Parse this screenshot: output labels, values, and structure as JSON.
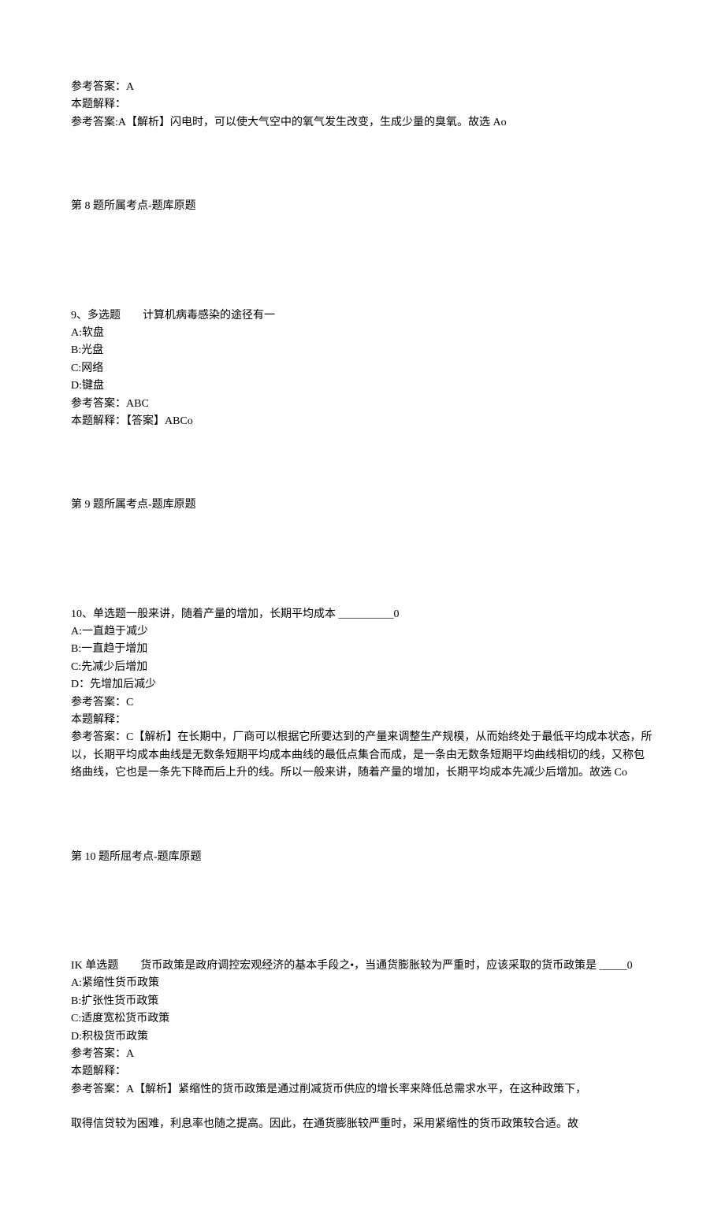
{
  "q8tail": {
    "ref_answer_label": "参考答案：A",
    "explain_label": "本题解释：",
    "explain_text": "参考答案:A【解析】闪电时，可以使大气空中的氧气发生改变，生成少量的臭氧。故选 Ao",
    "topic_label": "第 8 题所属考点-题库原题"
  },
  "q9": {
    "stem": "9、多选题　　计算机病毒感染的途径有一",
    "opts": {
      "a": "A:软盘",
      "b": "B:光盘",
      "c": "C:网络",
      "d": "D:键盘"
    },
    "ref_answer": "参考答案：ABC",
    "explain": "本题解释：【答案】ABCo",
    "topic_label": "第 9 题所属考点-题库原题"
  },
  "q10": {
    "stem": "10、单选题一般来讲，随着产量的增加，长期平均成本 __________0",
    "opts": {
      "a": "A:一直趋于减少",
      "b": "B:一直趋于增加",
      "c": "C:先减少后增加",
      "d": "D：先增加后减少"
    },
    "ref_answer": "参考答案：C",
    "explain_label": "本题解释：",
    "explain_text": "参考答案：C【解析】在长期中，厂商可以根据它所要达到的产量来调整生产规模，从而始终处于最低平均成本状态，所以，长期平均成本曲线是无数条短期平均成本曲线的最低点集合而成，是一条由无数条短期平均曲线相切的线，又称包络曲线，它也是一条先下降而后上升的线。所以一般来讲，随着产量的增加，长期平均成本先减少后增加。故选 Co",
    "topic_label": "第 10 题所屈考点-题库原题"
  },
  "q11": {
    "stem": "IK 单选题　　货币政策是政府调控宏观经济的基本手段之•，当通货膨胀较为严重时，应该采取的货币政策是 _____0",
    "opts": {
      "a": "A:紧缩性货币政策",
      "b": "B:扩张性货币政策",
      "c": "C:适度宽松货币政策",
      "d": "D:积极货币政策"
    },
    "ref_answer": "参考答案：A",
    "explain_label": "本题解释：",
    "explain_text1": "参考答案：A【解析】紧缩性的货币政策是通过削减货币供应的增长率来降低总需求水平，在这种政策下，",
    "explain_text2": "取得信贷较为困难，利息率也随之提高。因此，在通货膨胀较严重时，采用紧缩性的货币政策较合适。故"
  }
}
